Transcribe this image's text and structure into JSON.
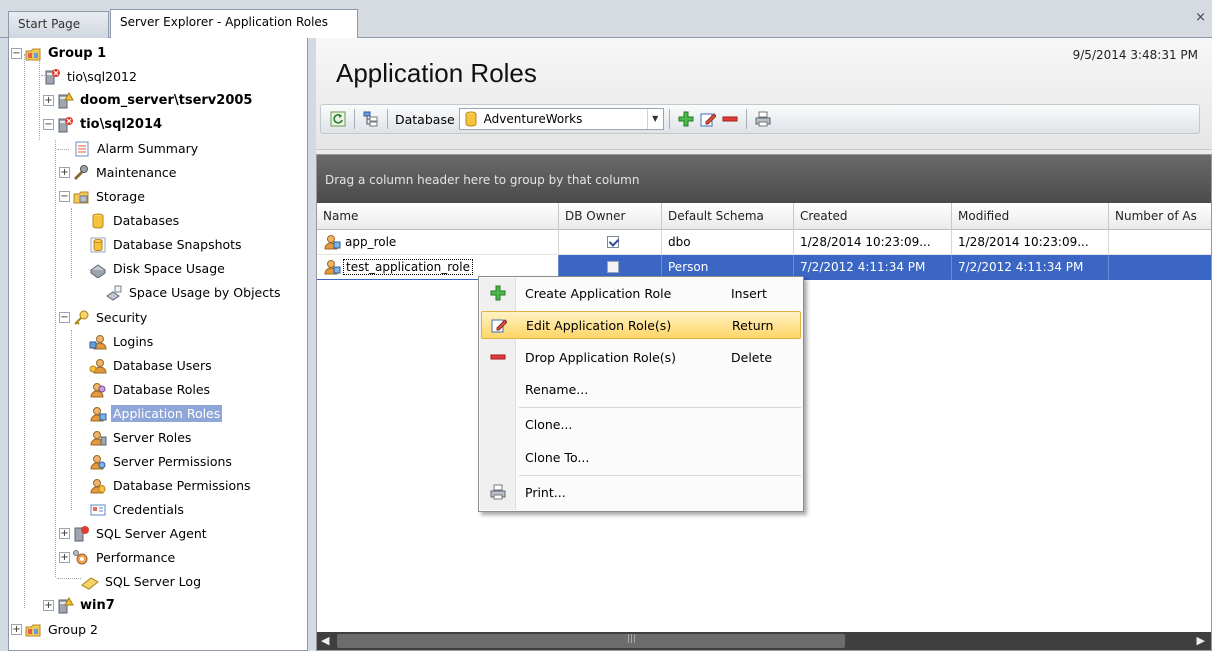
{
  "tabs": {
    "start_page": "Start Page",
    "active": "Server Explorer - Application Roles",
    "close_glyph": "×"
  },
  "tree": {
    "group1": "Group 1",
    "sql2012": "tio\\sql2012",
    "doom_server": "doom_server\\tserv2005",
    "sql2014": "tio\\sql2014",
    "alarm_summary": "Alarm Summary",
    "maintenance": "Maintenance",
    "storage": "Storage",
    "databases": "Databases",
    "database_snapshots": "Database Snapshots",
    "disk_space_usage": "Disk Space Usage",
    "space_usage_by_objects": "Space Usage by Objects",
    "security": "Security",
    "logins": "Logins",
    "database_users": "Database Users",
    "database_roles": "Database Roles",
    "application_roles": "Application Roles",
    "server_roles": "Server Roles",
    "server_permissions": "Server Permissions",
    "database_permissions": "Database Permissions",
    "credentials": "Credentials",
    "sql_server_agent": "SQL Server Agent",
    "performance": "Performance",
    "sql_server_log": "SQL Server Log",
    "win7": "win7",
    "group2": "Group 2",
    "expand_plus": "+",
    "expand_minus": "−"
  },
  "header": {
    "title": "Application Roles",
    "timestamp": "9/5/2014 3:48:31 PM"
  },
  "toolbar": {
    "database_label": "Database",
    "database_value": "AdventureWorks",
    "dropdown_glyph": "▼"
  },
  "grid": {
    "group_hint": "Drag a column header here to group by that column",
    "columns": {
      "name": "Name",
      "db_owner": "DB Owner",
      "default_schema": "Default Schema",
      "created": "Created",
      "modified": "Modified",
      "number_of_as": "Number of As"
    },
    "rows": [
      {
        "name": "app_role",
        "db_owner": true,
        "schema": "dbo",
        "created": "1/28/2014 10:23:09...",
        "modified": "1/28/2014 10:23:09..."
      },
      {
        "name": "test_application_role",
        "db_owner": false,
        "schema": "Person",
        "created": "7/2/2012 4:11:34 PM",
        "modified": "7/2/2012 4:11:34 PM"
      }
    ],
    "scroll_left": "◀",
    "scroll_right": "▶",
    "scroll_grip": "|||"
  },
  "context_menu": {
    "create": {
      "label": "Create Application Role",
      "key": "Insert"
    },
    "edit": {
      "label": "Edit Application Role(s)",
      "key": "Return"
    },
    "drop": {
      "label": "Drop Application Role(s)",
      "key": "Delete"
    },
    "rename": "Rename...",
    "clone": "Clone...",
    "clone_to": "Clone To...",
    "print": "Print..."
  },
  "colors": {
    "selection": "#3b66c4",
    "tree_selection": "#8fa6d8",
    "menu_highlight": "#ffd667",
    "add_green": "#2e9a2e",
    "drop_red": "#d42a2a"
  }
}
